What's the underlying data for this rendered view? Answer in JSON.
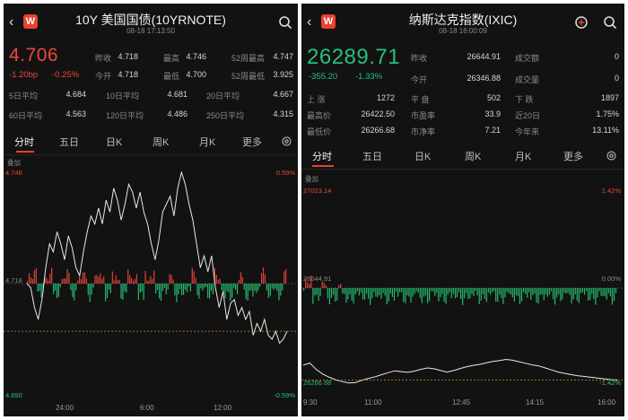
{
  "left": {
    "title": "10Y 美国国债(10YRNOTE)",
    "timestamp": "08-18 17:13:50",
    "price": "4.706",
    "change": "-1.20bp",
    "change_pct": "-0.25%",
    "stats": [
      {
        "label": "昨收",
        "value": "4.718"
      },
      {
        "label": "最高",
        "value": "4.746"
      },
      {
        "label": "52周最高",
        "value": "4.747"
      },
      {
        "label": "今开",
        "value": "4.718"
      },
      {
        "label": "最低",
        "value": "4.700"
      },
      {
        "label": "52周最低",
        "value": "3.925"
      }
    ],
    "averages": [
      {
        "label": "5日平均",
        "value": "4.684"
      },
      {
        "label": "10日平均",
        "value": "4.681"
      },
      {
        "label": "20日平均",
        "value": "4.667"
      },
      {
        "label": "60日平均",
        "value": "4.563"
      },
      {
        "label": "120日平均",
        "value": "4.486"
      },
      {
        "label": "250日平均",
        "value": "4.315"
      }
    ],
    "tabs": [
      "分时",
      "五日",
      "日K",
      "周K",
      "月K",
      "更多"
    ],
    "overlay_label": "叠加",
    "axis_top_value": "4.746",
    "axis_top_pct": "0.59%",
    "axis_bottom_value": "4.690",
    "axis_bottom_pct": "-0.59%",
    "mid_value": "4.718",
    "x_ticks": [
      "24:00",
      "6:00",
      "12:00"
    ],
    "chart_data": {
      "type": "line",
      "ylim": [
        4.69,
        4.746
      ],
      "prev_close": 4.718,
      "values": [
        4.718,
        4.717,
        4.712,
        4.709,
        4.714,
        4.722,
        4.728,
        4.726,
        4.731,
        4.728,
        4.724,
        4.73,
        4.727,
        4.722,
        4.72,
        4.726,
        4.731,
        4.735,
        4.733,
        4.737,
        4.733,
        4.739,
        4.736,
        4.742,
        4.739,
        4.734,
        4.738,
        4.743,
        4.741,
        4.737,
        4.741,
        4.736,
        4.733,
        4.728,
        4.724,
        4.729,
        4.736,
        4.738,
        4.74,
        4.735,
        4.742,
        4.746,
        4.743,
        4.738,
        4.734,
        4.728,
        4.722,
        4.725,
        4.721,
        4.725,
        4.717,
        4.712,
        4.716,
        4.709,
        4.713,
        4.714,
        4.71,
        4.712,
        4.709,
        4.711,
        4.705,
        4.708,
        4.706,
        4.709,
        4.705,
        4.704,
        4.706,
        4.703,
        4.704,
        4.706
      ]
    }
  },
  "right": {
    "title": "纳斯达克指数(IXIC)",
    "timestamp": "08-18 16:00:09",
    "price": "26289.71",
    "change": "-355.20",
    "change_pct": "-1.33%",
    "stats": [
      {
        "label": "昨收",
        "value": "26644.91"
      },
      {
        "label": "成交额",
        "value": "0"
      },
      {
        "label": "今开",
        "value": "26346.88"
      },
      {
        "label": "成交量",
        "value": "0"
      }
    ],
    "breadth": [
      {
        "label": "上 涨",
        "value": "1272"
      },
      {
        "label": "平 盘",
        "value": "502"
      },
      {
        "label": "下 跌",
        "value": "1897"
      },
      {
        "label": "最高价",
        "value": "26422.50"
      },
      {
        "label": "市盈率",
        "value": "33.9"
      },
      {
        "label": "近20日",
        "value": "1.75%"
      },
      {
        "label": "最低价",
        "value": "26266.68"
      },
      {
        "label": "市净率",
        "value": "7.21"
      },
      {
        "label": "今年来",
        "value": "13.11%"
      }
    ],
    "tabs": [
      "分时",
      "五日",
      "日K",
      "周K",
      "月K",
      "更多"
    ],
    "overlay_label": "叠加",
    "axis_top_value": "27023.14",
    "axis_top_pct": "1.42%",
    "axis_zero_value": "26644.91",
    "axis_zero_pct": "0.00%",
    "axis_bottom_value": "26266.68",
    "axis_bottom_pct": "-1.42%",
    "x_ticks": [
      "9:30",
      "11:00",
      "12:45",
      "14:15",
      "16:00"
    ],
    "chart_data": {
      "type": "line",
      "ylim": [
        26266.68,
        27023.14
      ],
      "prev_close": 26644.91,
      "values": [
        26346.88,
        26355,
        26330,
        26312,
        26300,
        26290,
        26283,
        26278,
        26280,
        26289,
        26296,
        26302,
        26310,
        26318,
        26325,
        26322,
        26319,
        26324,
        26331,
        26336,
        26333,
        26326,
        26320,
        26326,
        26334,
        26341,
        26346,
        26350,
        26356,
        26361,
        26365,
        26369,
        26366,
        26360,
        26354,
        26348,
        26344,
        26336,
        26328,
        26320,
        26315,
        26310,
        26306,
        26303,
        26300,
        26297,
        26294,
        26291,
        26289.71
      ]
    }
  }
}
